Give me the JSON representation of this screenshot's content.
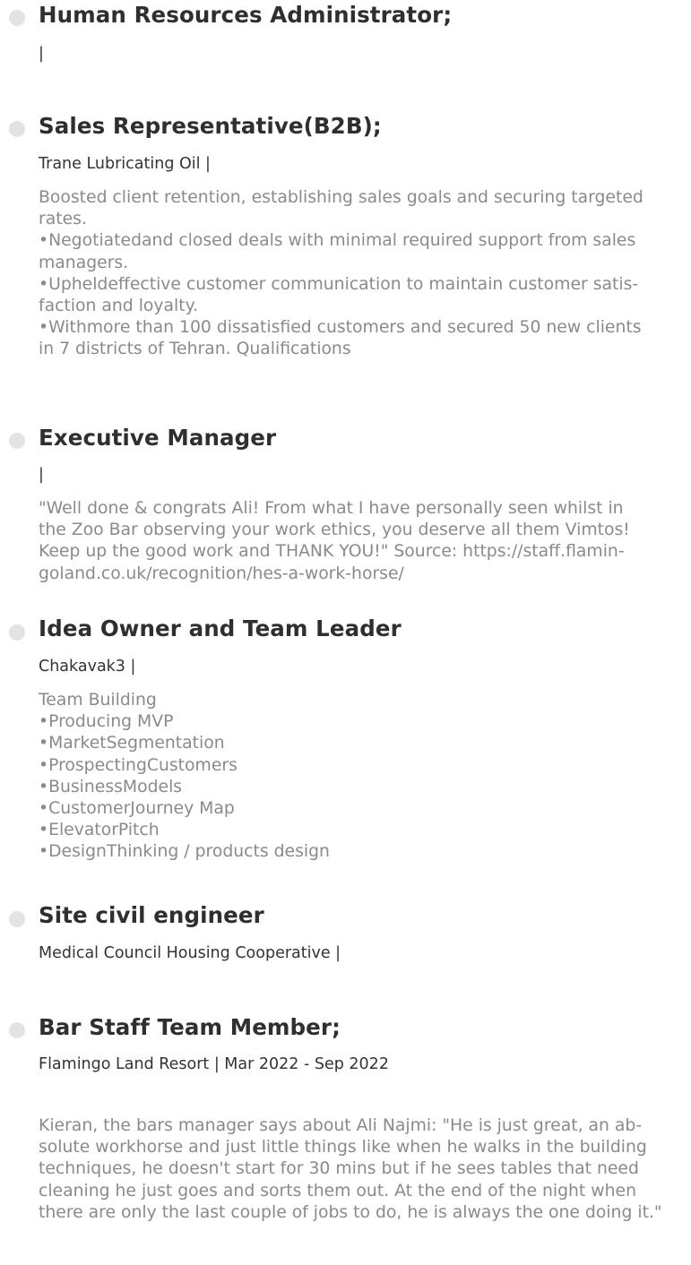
{
  "experience": [
    {
      "title": "Human Resources Administrator;",
      "meta": "|",
      "description_lines": []
    },
    {
      "title": "Sales Representative(B2B);",
      "meta": "Trane Lubricating Oil |",
      "description_lines": [
        "Boosted client retention, establishing sales goals and securing targeted",
        "rates.",
        "•Negotiatedand closed deals with minimal required support from sales",
        "managers.",
        "•Upheldeffective customer communication to maintain customer satis-",
        "faction and loyalty.",
        "•Withmore than 100 dissatisfied customers and secured 50 new clients",
        "in 7 districts of Tehran. Qualifications"
      ]
    },
    {
      "title": "Executive Manager",
      "meta": "|",
      "description_lines": [
        "\"Well done & congrats Ali! From what I have personally seen whilst in",
        "the Zoo Bar observing your work ethics, you deserve all them Vimtos!",
        "Keep up the good work and THANK YOU!\" Source: https://staff.flamin-",
        "goland.co.uk/recognition/hes-a-work-horse/"
      ]
    },
    {
      "title": "Idea Owner and Team Leader",
      "meta": "Chakavak3 |",
      "description_lines": [
        "Team Building",
        "•Producing MVP",
        "•MarketSegmentation",
        "•ProspectingCustomers",
        "•BusinessModels",
        "•CustomerJourney Map",
        "•ElevatorPitch",
        "•DesignThinking / products design"
      ]
    },
    {
      "title": "Site civil engineer",
      "meta": "Medical Council Housing Cooperative |",
      "description_lines": []
    },
    {
      "title": "Bar Staff Team Member;",
      "meta": "Flamingo Land Resort | Mar 2022 - Sep 2022",
      "description_lines": [
        "Kieran, the bars manager says about Ali Najmi: \"He is just great, an ab-",
        "solute workhorse and just little things like when he walks in the building",
        "techniques, he doesn't start for 30 mins but if he sees tables that need",
        "cleaning he just goes and sorts them out. At the end of the night when",
        "there are only the last couple of jobs to do, he is always the one doing it.\""
      ]
    }
  ]
}
